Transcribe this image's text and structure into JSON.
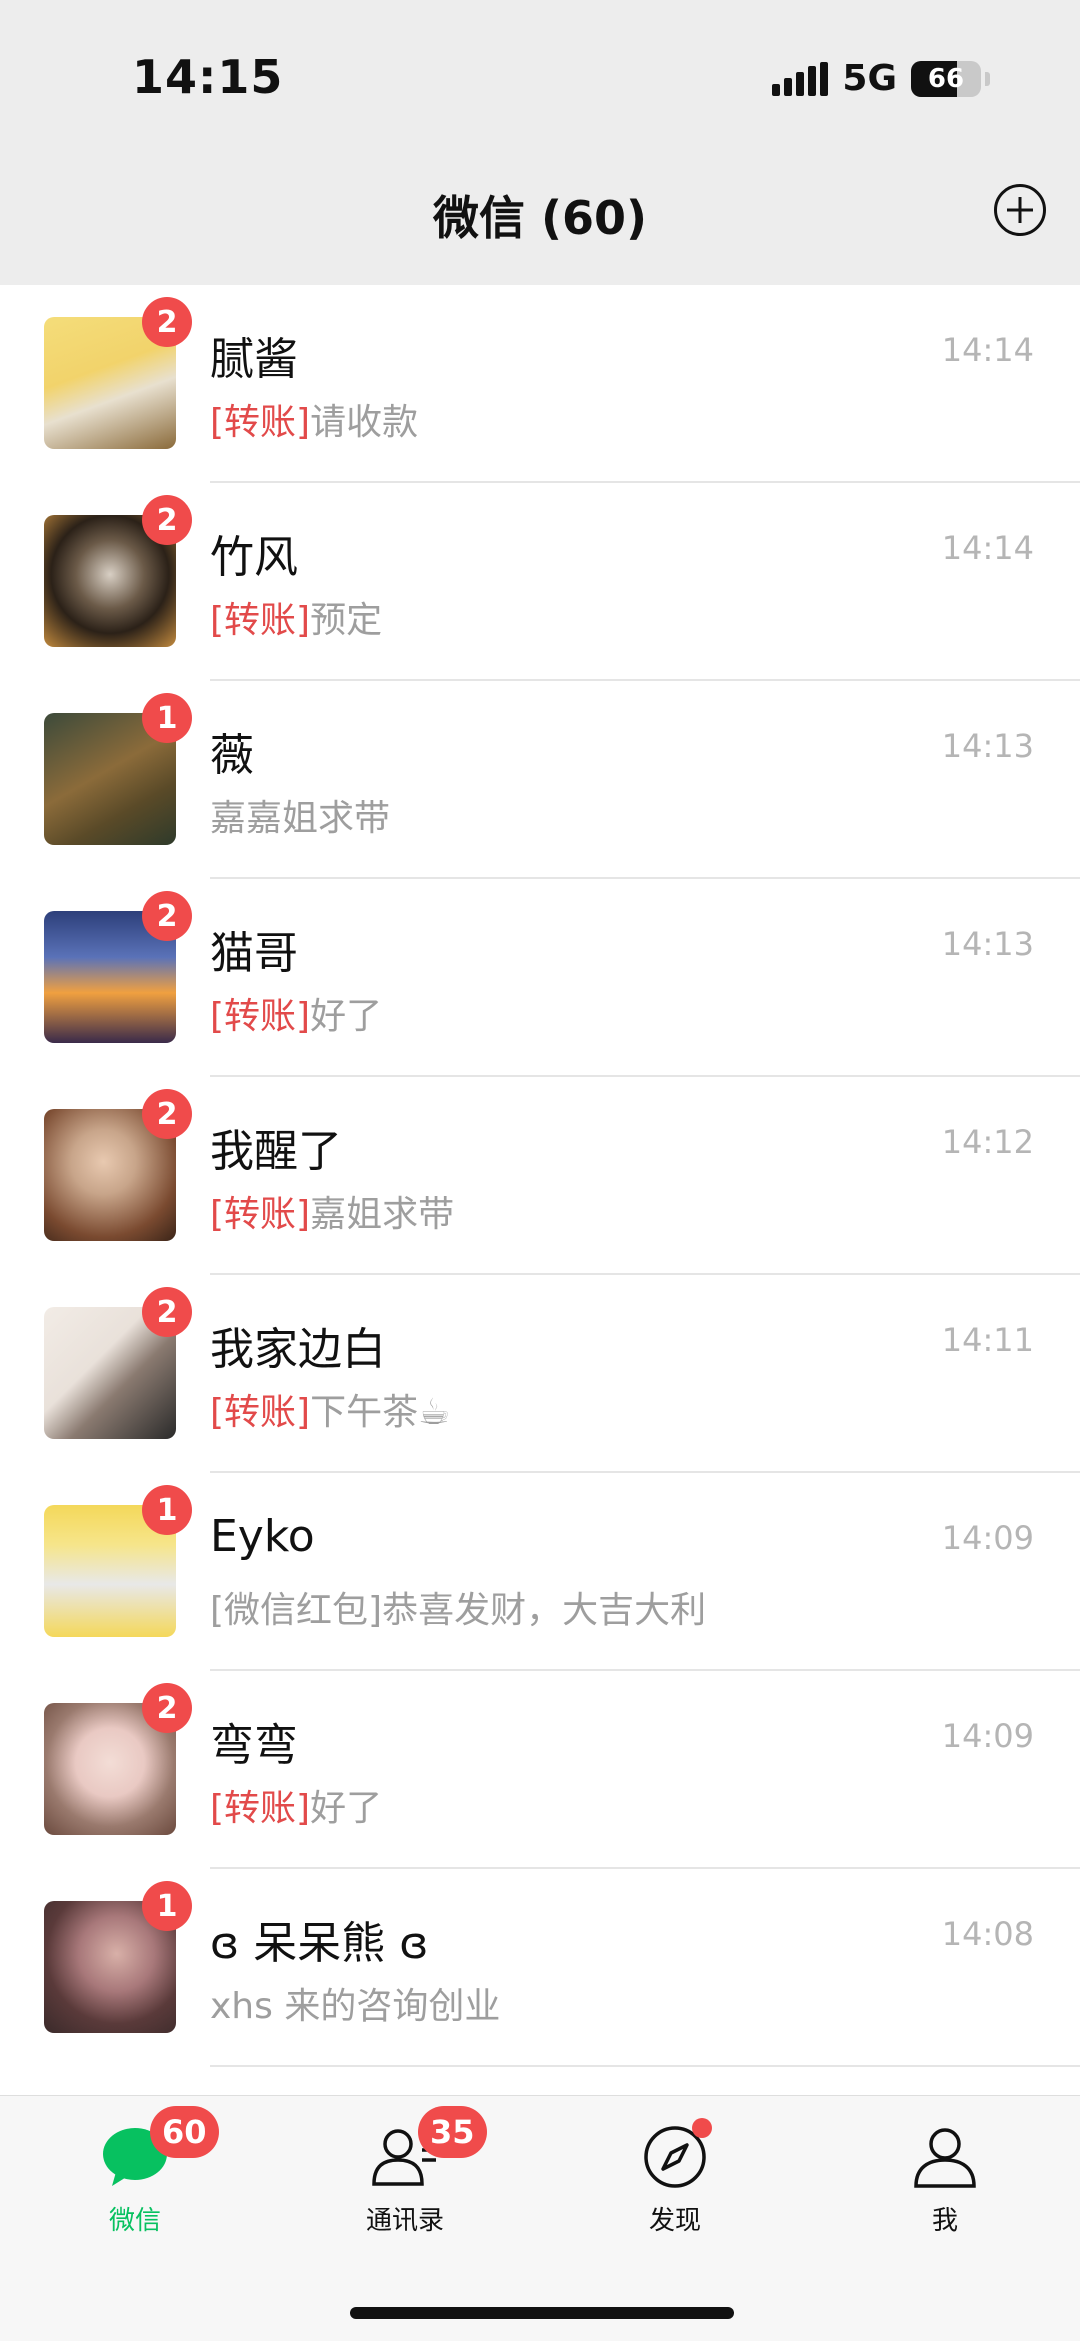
{
  "status_bar": {
    "time": "14:15",
    "network": "5G",
    "battery_level": "66"
  },
  "header": {
    "title": "微信 (60)",
    "add_icon": "plus-circle-icon"
  },
  "chats": [
    {
      "name": "腻酱",
      "badge": "2",
      "time": "14:14",
      "tag": "[转账]",
      "preview": "请收款",
      "avatar_colors": [
        "#f2d36b",
        "#8a6a3a"
      ]
    },
    {
      "name": "竹风",
      "badge": "2",
      "time": "14:14",
      "tag": "[转账]",
      "preview": "预定",
      "avatar_colors": [
        "#2b2118",
        "#c28a3e"
      ]
    },
    {
      "name": "薇",
      "badge": "1",
      "time": "14:13",
      "tag": "",
      "preview": "嘉嘉姐求带",
      "avatar_colors": [
        "#5a4a28",
        "#8b6b3a"
      ]
    },
    {
      "name": "猫哥",
      "badge": "2",
      "time": "14:13",
      "tag": "[转账]",
      "preview": "好了",
      "avatar_colors": [
        "#3b4f8a",
        "#f0a040"
      ]
    },
    {
      "name": "我醒了",
      "badge": "2",
      "time": "14:12",
      "tag": "[转账]",
      "preview": "嘉姐求带",
      "avatar_colors": [
        "#c8a58a",
        "#7a4a30"
      ]
    },
    {
      "name": "我家边白",
      "badge": "2",
      "time": "14:11",
      "tag": "[转账]",
      "preview": "下午茶☕",
      "avatar_colors": [
        "#e9e1da",
        "#2a2a2a"
      ]
    },
    {
      "name": "Eyko",
      "badge": "1",
      "time": "14:09",
      "tag": "",
      "preview": "[微信红包]恭喜发财，大吉大利",
      "avatar_colors": [
        "#f4d85a",
        "#e8e8e8"
      ]
    },
    {
      "name": "弯弯",
      "badge": "2",
      "time": "14:09",
      "tag": "[转账]",
      "preview": "好了",
      "avatar_colors": [
        "#e9c9c3",
        "#6b4a3e"
      ]
    },
    {
      "name": "ɞ 呆呆熊 ɞ",
      "badge": "1",
      "time": "14:08",
      "tag": "",
      "preview": "xhs 来的咨询创业",
      "avatar_colors": [
        "#3a2a2a",
        "#a8787a"
      ]
    }
  ],
  "tabs": [
    {
      "label": "微信",
      "icon": "chat-bubble-icon",
      "badge": "60",
      "active": true
    },
    {
      "label": "通讯录",
      "icon": "contacts-icon",
      "badge": "35",
      "active": false
    },
    {
      "label": "发现",
      "icon": "compass-icon",
      "badge": "",
      "active": false,
      "dot": true
    },
    {
      "label": "我",
      "icon": "person-icon",
      "badge": "",
      "active": false
    }
  ],
  "colors": {
    "accent_green": "#07c160",
    "badge_red": "#f04b4b",
    "tag_red": "#e24a4a"
  }
}
